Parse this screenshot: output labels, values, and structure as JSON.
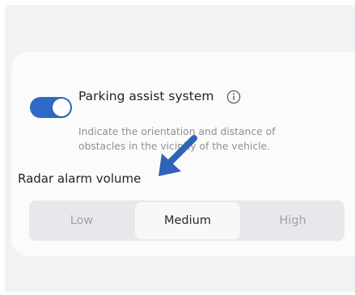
{
  "parking_assist": {
    "title": "Parking assist system",
    "description": "Indicate the orientation and distance of obstacles in the vicinity of the vehicle.",
    "enabled": true,
    "info_icon": "info-circle-icon"
  },
  "radar_alarm": {
    "label": "Radar alarm volume",
    "options": [
      "Low",
      "Medium",
      "High"
    ],
    "selected": "Medium"
  },
  "annotation": {
    "icon": "arrow-pointer-icon",
    "color": "#2f63b6"
  },
  "colors": {
    "accent": "#2f69c6"
  }
}
